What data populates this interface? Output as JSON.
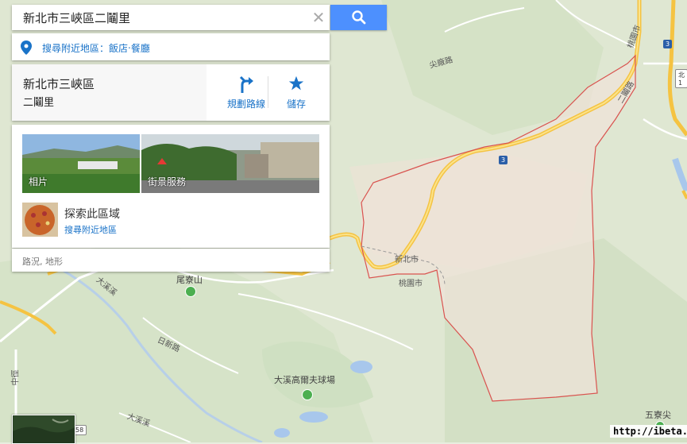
{
  "search": {
    "value": "新北市三峽區二鬮里"
  },
  "nearby": {
    "prefix": "搜尋附近地區：",
    "link": "飯店‧餐廳"
  },
  "place": {
    "name_line1": "新北市三峽區",
    "name_line2": "二鬮里"
  },
  "actions": {
    "route_label": "規劃路線",
    "save_label": "儲存"
  },
  "media": {
    "photos_label": "相片",
    "street_label": "街景服務"
  },
  "explore": {
    "title": "探索此區域",
    "link": "搜尋附近地區"
  },
  "layers": {
    "text": "路況, 地形"
  },
  "map_labels": {
    "shaliao_road": "尖廠路",
    "route3": "3",
    "ermin_road": "二鬮路",
    "taoyuan_city": "桃園市",
    "newtaipei": "新北市",
    "boundary_taoyuan": "桃園市",
    "daxi_river": "大溪溪",
    "weiliao_shan": "尾寮山",
    "rixin_road": "日新路",
    "golf": "大溪高爾夫球場",
    "wuliao_jian": "五寮尖",
    "route58": "58",
    "north1": "北1",
    "zhongxin": "中徑",
    "daxixi2": "大溪溪"
  },
  "watermark": "http://ibeta.tw",
  "colors": {
    "boundary": "#d9534f",
    "road": "#f5c342",
    "search_btn": "#4d90fe",
    "link": "#1a73c8"
  }
}
